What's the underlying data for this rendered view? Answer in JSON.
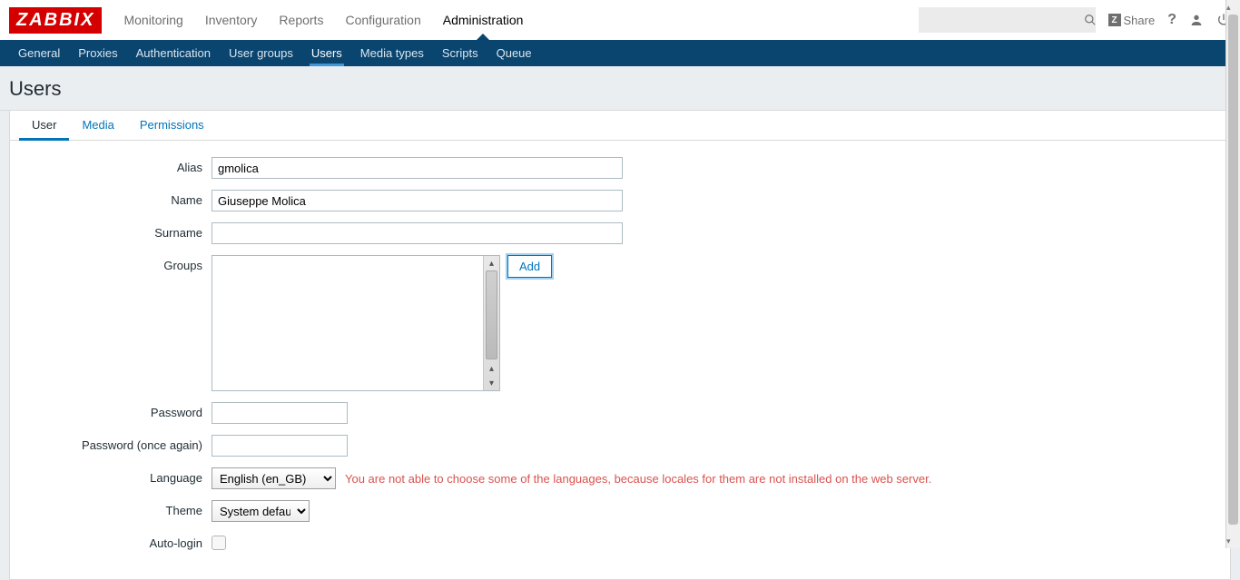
{
  "brand": "ZABBIX",
  "top_menu": [
    {
      "label": "Monitoring"
    },
    {
      "label": "Inventory"
    },
    {
      "label": "Reports"
    },
    {
      "label": "Configuration"
    },
    {
      "label": "Administration",
      "active": true
    }
  ],
  "top_right": {
    "share": "Share",
    "help": "?",
    "search_placeholder": ""
  },
  "sub_nav": [
    {
      "label": "General"
    },
    {
      "label": "Proxies"
    },
    {
      "label": "Authentication"
    },
    {
      "label": "User groups"
    },
    {
      "label": "Users",
      "active": true
    },
    {
      "label": "Media types"
    },
    {
      "label": "Scripts"
    },
    {
      "label": "Queue"
    }
  ],
  "page_title": "Users",
  "tabs": [
    {
      "label": "User",
      "active": true
    },
    {
      "label": "Media"
    },
    {
      "label": "Permissions"
    }
  ],
  "form": {
    "alias_label": "Alias",
    "alias_value": "gmolica",
    "name_label": "Name",
    "name_value": "Giuseppe Molica",
    "surname_label": "Surname",
    "surname_value": "",
    "groups_label": "Groups",
    "add_button": "Add",
    "password_label": "Password",
    "password_value": "",
    "password2_label": "Password (once again)",
    "password2_value": "",
    "language_label": "Language",
    "language_value": "English (en_GB)",
    "language_warning": "You are not able to choose some of the languages, because locales for them are not installed on the web server.",
    "theme_label": "Theme",
    "theme_value": "System default",
    "autologin_label": "Auto-login"
  }
}
